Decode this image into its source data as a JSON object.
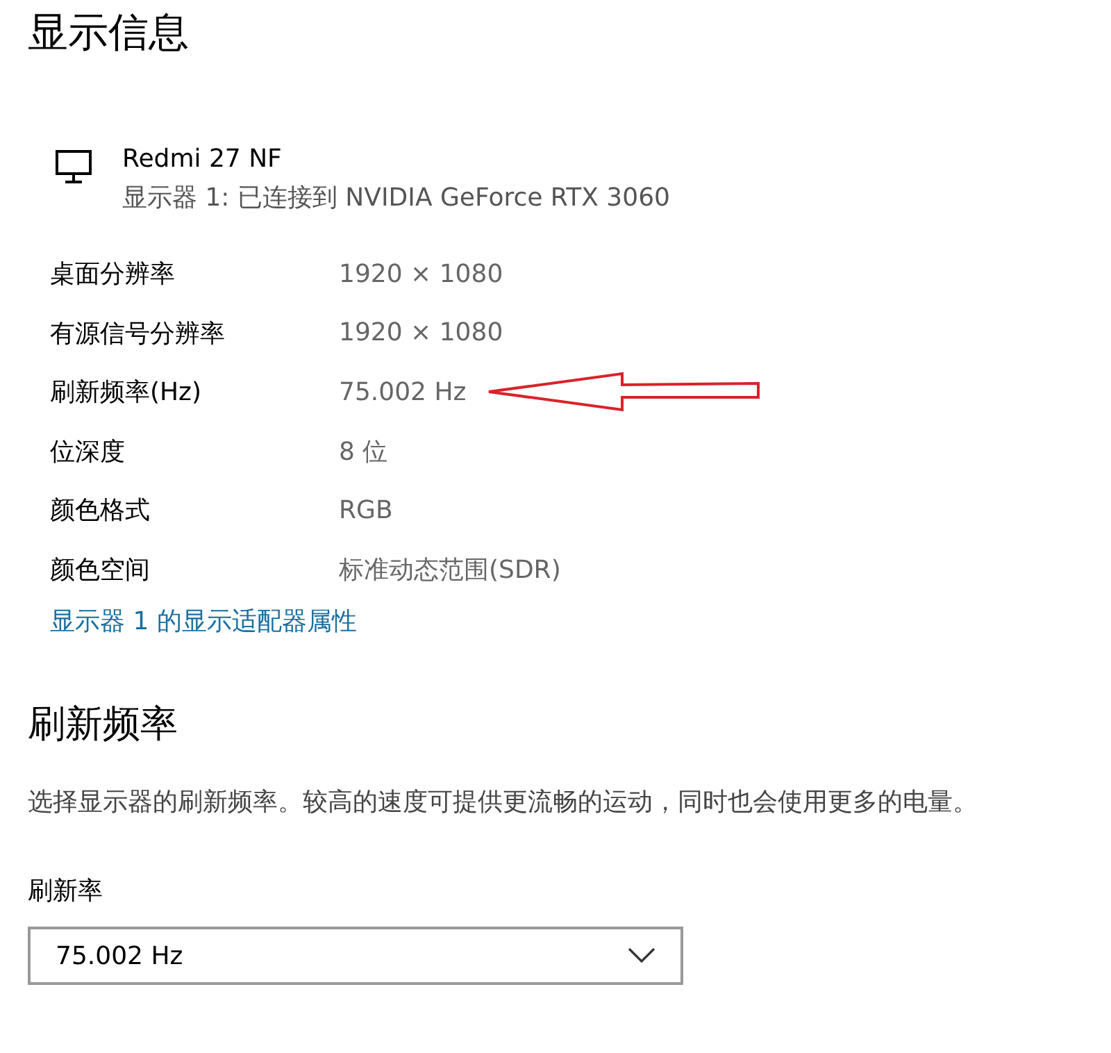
{
  "title": "显示信息",
  "monitor": {
    "name": "Redmi 27 NF",
    "connection": "显示器 1: 已连接到 NVIDIA GeForce RTX 3060"
  },
  "properties": [
    {
      "label": "桌面分辨率",
      "value": "1920 × 1080",
      "annotated": false
    },
    {
      "label": "有源信号分辨率",
      "value": "1920 × 1080",
      "annotated": false
    },
    {
      "label": "刷新频率(Hz)",
      "value": "75.002 Hz",
      "annotated": true
    },
    {
      "label": "位深度",
      "value": "8 位",
      "annotated": false
    },
    {
      "label": "颜色格式",
      "value": "RGB",
      "annotated": false
    },
    {
      "label": "颜色空间",
      "value": "标准动态范围(SDR)",
      "annotated": false
    }
  ],
  "adapter_link": "显示器 1 的显示适配器属性",
  "refresh": {
    "heading": "刷新频率",
    "description": "选择显示器的刷新频率。较高的速度可提供更流畅的运动，同时也会使用更多的电量。",
    "field_label": "刷新率",
    "selected_rate": "75.002 Hz"
  }
}
